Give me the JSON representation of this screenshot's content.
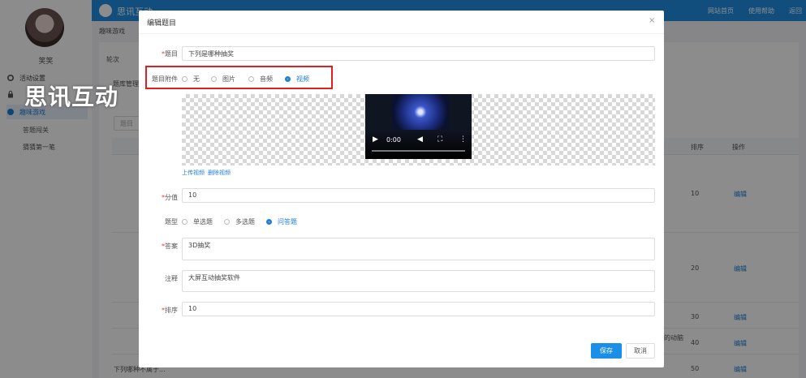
{
  "sidebar": {
    "username": "笑笑",
    "items": [
      {
        "label": "活动设置",
        "icon": "gear-icon"
      },
      {
        "label": "",
        "icon": "lock-icon"
      },
      {
        "label": "趣味游戏",
        "icon": "globe-icon"
      }
    ],
    "subitems": [
      "答题闯关",
      "猜猜第一笔"
    ]
  },
  "topbar": {
    "title": "思讯互动",
    "links": [
      "网站首页",
      "使用帮助",
      "返回"
    ]
  },
  "background": {
    "breadcrumb": "趣味游戏",
    "tabs": [
      "轮次",
      "题"
    ],
    "sub_label": "题库管理",
    "search_placeholder": "题目",
    "headers": [
      "排序",
      "操作"
    ],
    "rows": [
      {
        "order": "10",
        "action": "编辑"
      },
      {
        "order": "20",
        "action": "编辑"
      },
      {
        "order": "30",
        "action": "编辑"
      },
      {
        "order": "40",
        "action": "编辑"
      },
      {
        "order": "50",
        "action": "编辑"
      }
    ],
    "truncated_text": "的动脑",
    "bottom_row_text": "下列哪种不属于..."
  },
  "watermark": "思讯互动",
  "dialog": {
    "title": "编辑题目",
    "close": "×",
    "question_label": "题目",
    "question_value": "下列是哪种抽奖",
    "attachment_label": "题目附件",
    "attachment_options": [
      "无",
      "图片",
      "音频",
      "视频"
    ],
    "attachment_selected": "视频",
    "video_time": "0:00",
    "upload_link": "上传视频",
    "delete_link": "删除视频",
    "score_label": "分值",
    "score_value": "10",
    "type_label": "题型",
    "type_options": [
      "单选题",
      "多选题",
      "问答题"
    ],
    "type_selected": "问答题",
    "answer_label": "答案",
    "answer_value": "3D抽奖",
    "note_label": "注释",
    "note_value": "大屏互动抽奖软件",
    "sort_label": "排序",
    "sort_value": "10",
    "save_label": "保存",
    "cancel_label": "取消"
  },
  "colors": {
    "primary": "#1b8fe8",
    "topbar": "#1f8fe6",
    "highlight": "#e02020"
  }
}
